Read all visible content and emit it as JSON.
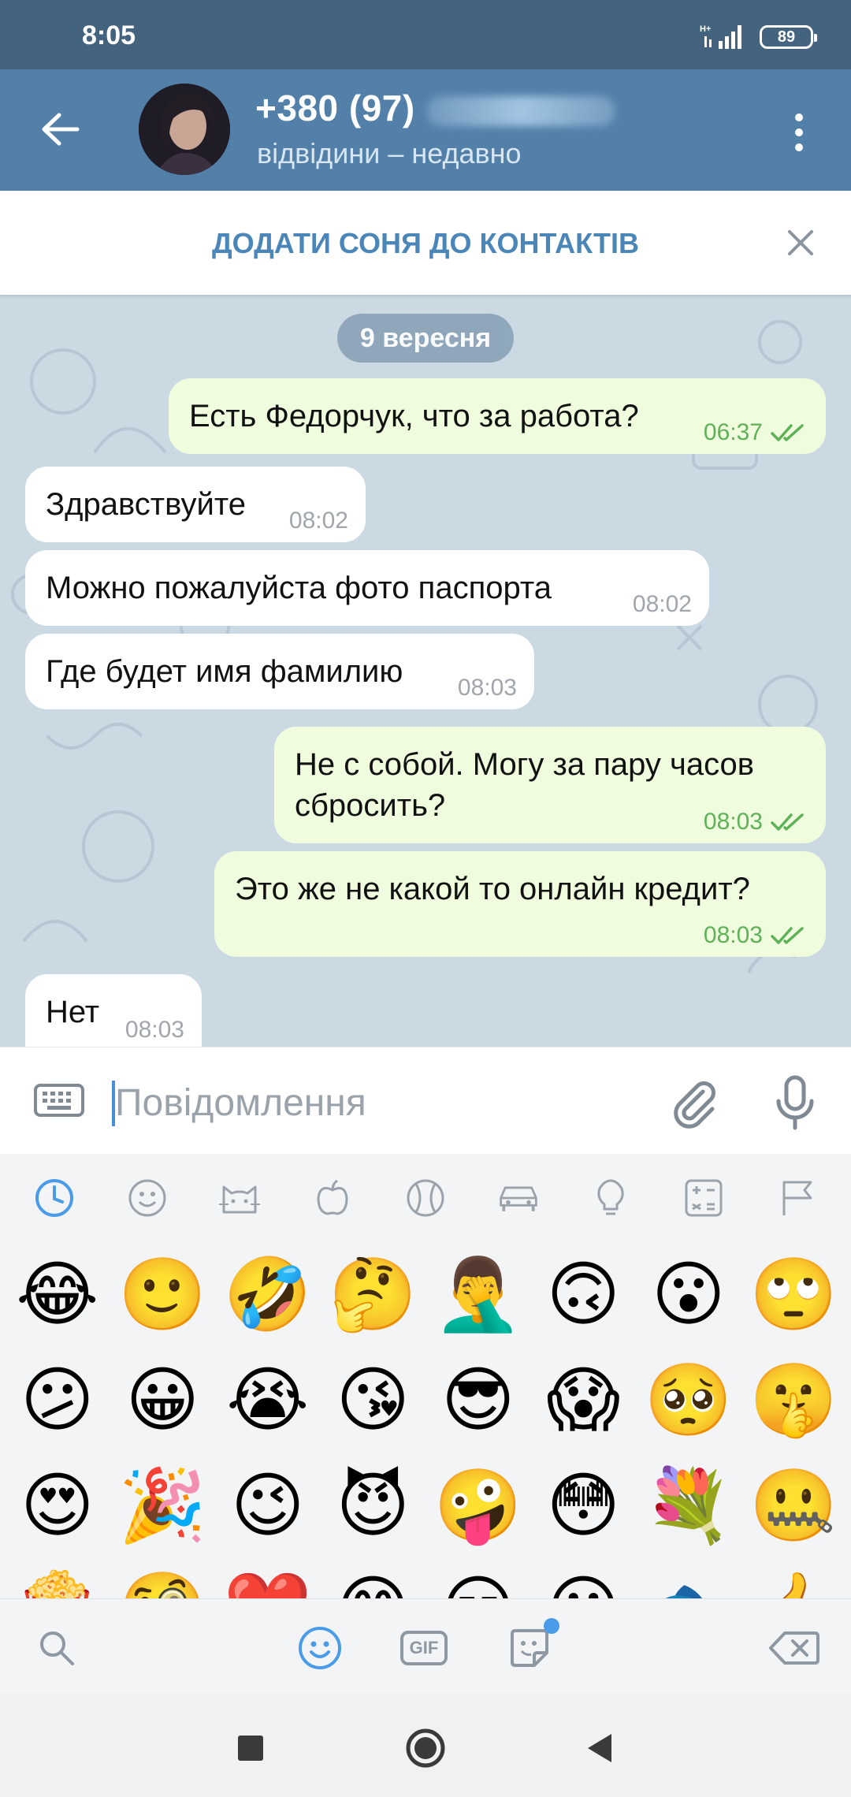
{
  "status_bar": {
    "time": "8:05",
    "network": "H+",
    "battery": "89"
  },
  "header": {
    "peer_name": "+380 (97)",
    "peer_status": "відвідини – недавно"
  },
  "add_contact": {
    "label": "ДОДАТИ СОНЯ ДО КОНТАКТІВ"
  },
  "chat": {
    "date_label": "9 вересня",
    "messages": [
      {
        "direction": "out",
        "text": "Есть Федорчук, что за работа?",
        "time": "06:37",
        "read": true
      },
      {
        "direction": "in",
        "text": "Здравствуйте",
        "time": "08:02"
      },
      {
        "direction": "in",
        "text": "Можно пожалуйста фото паспорта",
        "time": "08:02"
      },
      {
        "direction": "in",
        "text": "Где будет имя фамилию",
        "time": "08:03"
      },
      {
        "direction": "out",
        "text": "Не с собой. Могу за пару часов сбросить?",
        "time": "08:03",
        "read": true
      },
      {
        "direction": "out",
        "text": "Это же не какой то онлайн кредит?",
        "time": "08:03",
        "read": true
      },
      {
        "direction": "in",
        "text": "Нет",
        "time": "08:03"
      }
    ]
  },
  "input": {
    "placeholder": "Повідомлення"
  },
  "emoji_panel": {
    "categories": [
      "recent-icon",
      "smiley-icon",
      "cat-icon",
      "apple-icon",
      "ball-icon",
      "car-icon",
      "bulb-icon",
      "symbols-icon",
      "flag-icon"
    ],
    "rows": [
      [
        "😂",
        "🙂",
        "🤣",
        "🤔",
        "🤦‍♂️",
        "🙃",
        "😮",
        "🙄"
      ],
      [
        "😕",
        "😀",
        "😭",
        "😘",
        "😎",
        "😱",
        "🥺",
        "🤫"
      ],
      [
        "😍",
        "🎉",
        "😉",
        "😈",
        "🤪",
        "😳",
        "💐",
        "🤐"
      ],
      [
        "🍿",
        "🧐",
        "❤️",
        "😊",
        "😏",
        "😶",
        "🐟",
        "👍"
      ]
    ],
    "bottom_tabs": {
      "gif_label": "GIF"
    }
  },
  "colors": {
    "header": "#5280a9",
    "status_bar": "#44637e",
    "outgoing": "#effdde",
    "incoming": "#ffffff",
    "accent": "#4b86b8",
    "tick": "#5fb158"
  }
}
